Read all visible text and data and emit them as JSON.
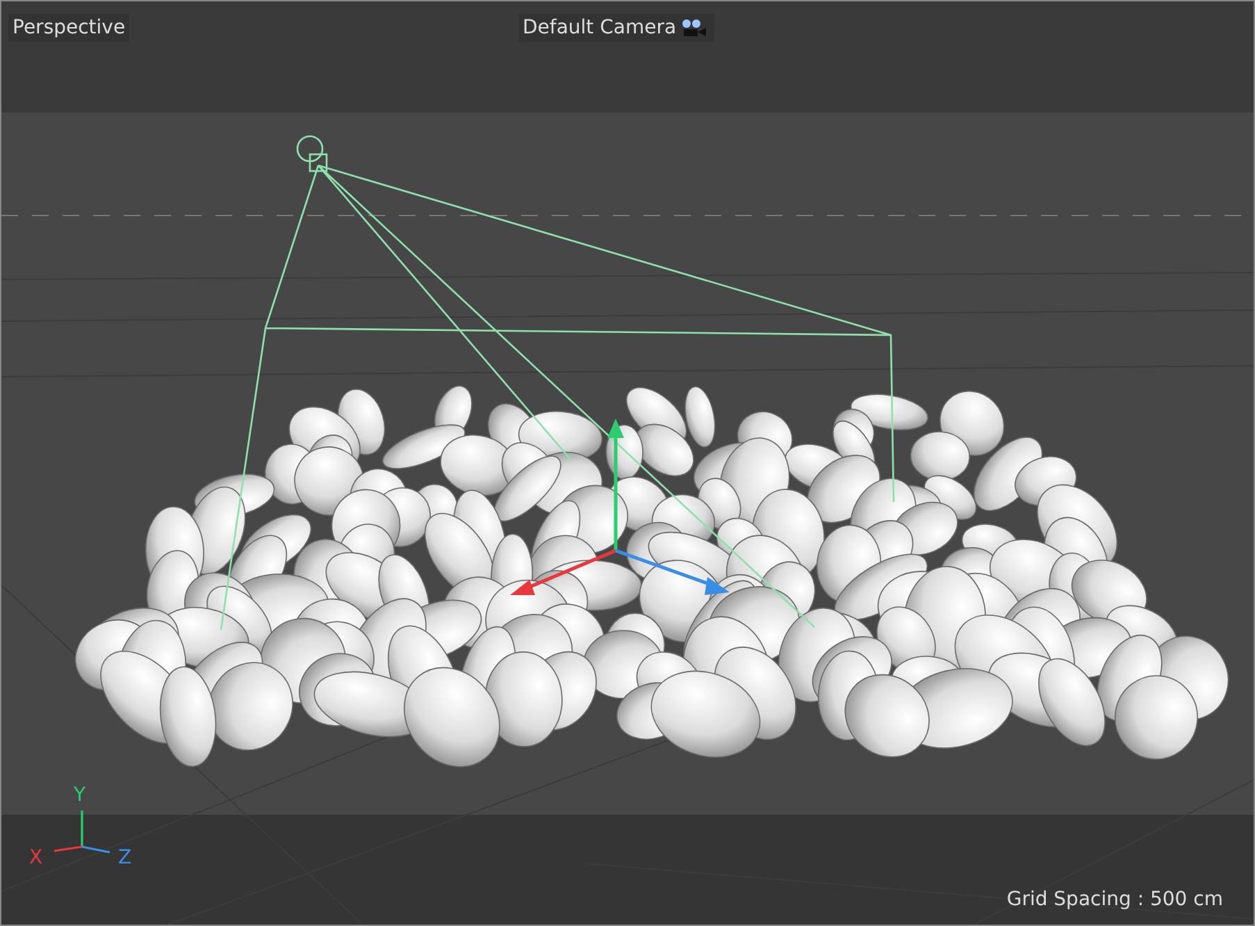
{
  "viewport": {
    "view_name": "Perspective",
    "camera_name": "Default Camera",
    "grid_spacing": "Grid Spacing : 500 cm",
    "axes": [
      {
        "label": "Y",
        "color": "#2ecc71"
      },
      {
        "label": "X",
        "color": "#e8383d"
      },
      {
        "label": "Z",
        "color": "#3a8ee6"
      }
    ]
  }
}
